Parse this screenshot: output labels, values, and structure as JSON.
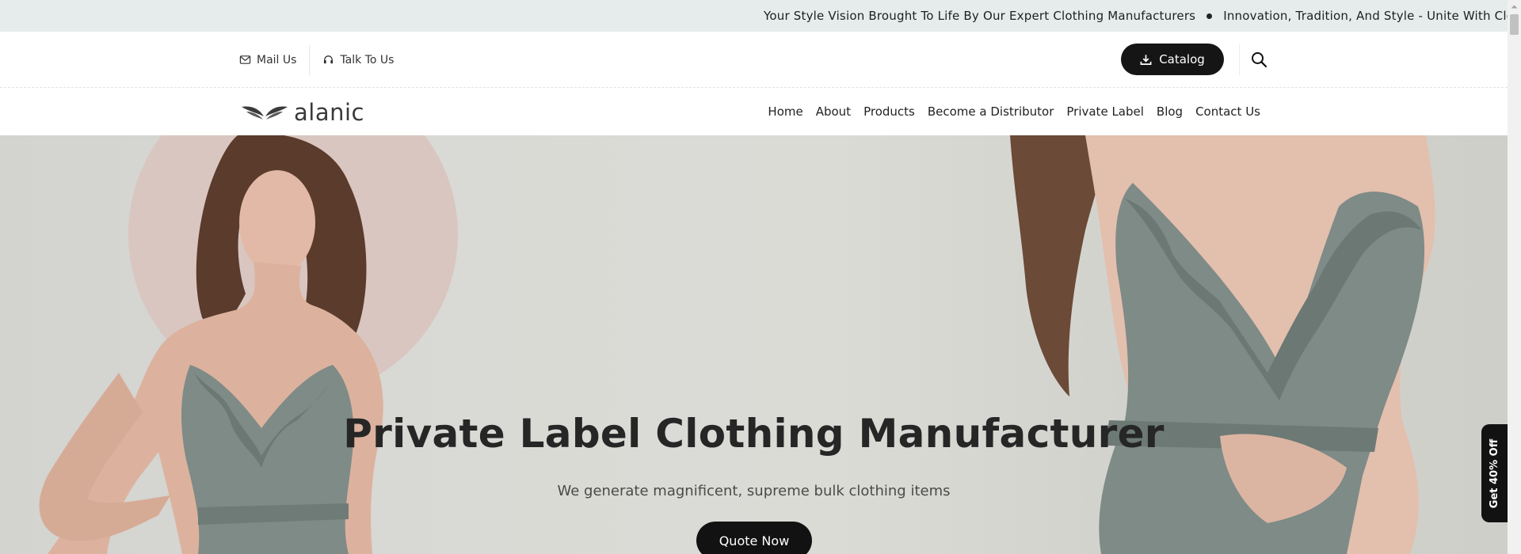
{
  "ticker": {
    "items": [
      "Your Style Vision Brought To Life By Our Expert Clothing Manufacturers",
      "Innovation, Tradition, And Style - Unite With Clothing"
    ]
  },
  "utility": {
    "mail_label": "Mail Us",
    "talk_label": "Talk To Us",
    "catalog_label": "Catalog"
  },
  "brand": {
    "name": "alanic"
  },
  "nav": {
    "items": [
      "Home",
      "About",
      "Products",
      "Become a Distributor",
      "Private Label",
      "Blog",
      "Contact Us"
    ]
  },
  "hero": {
    "title": "Private Label Clothing Manufacturer",
    "subtitle": "We generate magnificent, supreme bulk clothing items",
    "cta_label": "Quote Now"
  },
  "side_tab": {
    "label": "Get 40% Off"
  },
  "colors": {
    "ticker_bg": "#e6ecec",
    "button_dark": "#121212",
    "hero_bg": "#d8d8d4",
    "dress": "#7d8a86"
  }
}
